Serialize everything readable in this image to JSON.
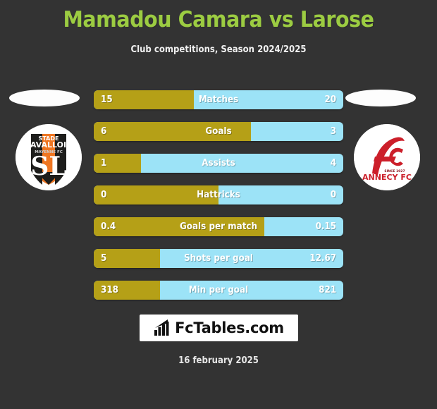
{
  "header": {
    "title": "Mamadou Camara vs Larose",
    "subtitle": "Club competitions, Season 2024/2025",
    "title_color": "#9ccc42"
  },
  "theme": {
    "background": "#333333",
    "home_bar_color": "#b5a017",
    "away_bar_color": "#9ce3f7",
    "text_color": "#ffffff"
  },
  "clubs": {
    "home": {
      "name": "Stade Lavallois",
      "crest_name": "stade-lavallois-crest",
      "crest_text_top": "STADE",
      "crest_text_main": "LAVALLOIS",
      "crest_text_sub": "MAYENNE FC",
      "crest_monogram": "SL",
      "color_primary": "#ef7622",
      "color_secondary": "#1d1d1b"
    },
    "away": {
      "name": "FC Annecy",
      "crest_name": "fc-annecy-crest",
      "crest_monogram": "FC",
      "crest_text_main": "ANNECY FC",
      "crest_text_sub": "SINCE 1927",
      "color_primary": "#cc1f2a",
      "color_secondary": "#8c1018"
    }
  },
  "chart_data": {
    "type": "bar",
    "title": "Mamadou Camara vs Larose",
    "subtitle": "Club competitions, Season 2024/2025",
    "orientation": "horizontal-opposed",
    "series": [
      {
        "name": "Mamadou Camara",
        "color": "#b5a017",
        "values": [
          15,
          6,
          1,
          0,
          0.4,
          5,
          318
        ]
      },
      {
        "name": "Larose",
        "color": "#9ce3f7",
        "values": [
          20,
          3,
          4,
          0,
          0.15,
          12.67,
          821
        ]
      }
    ],
    "categories": [
      "Matches",
      "Goals",
      "Assists",
      "Hattricks",
      "Goals per match",
      "Shots per goal",
      "Min per goal"
    ],
    "rows": [
      {
        "label": "Matches",
        "home": "15",
        "away": "20",
        "home_pct": 40.0
      },
      {
        "label": "Goals",
        "home": "6",
        "away": "3",
        "home_pct": 63.0
      },
      {
        "label": "Assists",
        "home": "1",
        "away": "4",
        "home_pct": 19.0
      },
      {
        "label": "Hattricks",
        "home": "0",
        "away": "0",
        "home_pct": 50.0
      },
      {
        "label": "Goals per match",
        "home": "0.4",
        "away": "0.15",
        "home_pct": 68.5
      },
      {
        "label": "Shots per goal",
        "home": "5",
        "away": "12.67",
        "home_pct": 26.5
      },
      {
        "label": "Min per goal",
        "home": "318",
        "away": "821",
        "home_pct": 26.5
      }
    ]
  },
  "brand": {
    "text": "FcTables.com",
    "icon": "bar-chart-arrow-icon"
  },
  "footer": {
    "date": "16 february 2025"
  }
}
